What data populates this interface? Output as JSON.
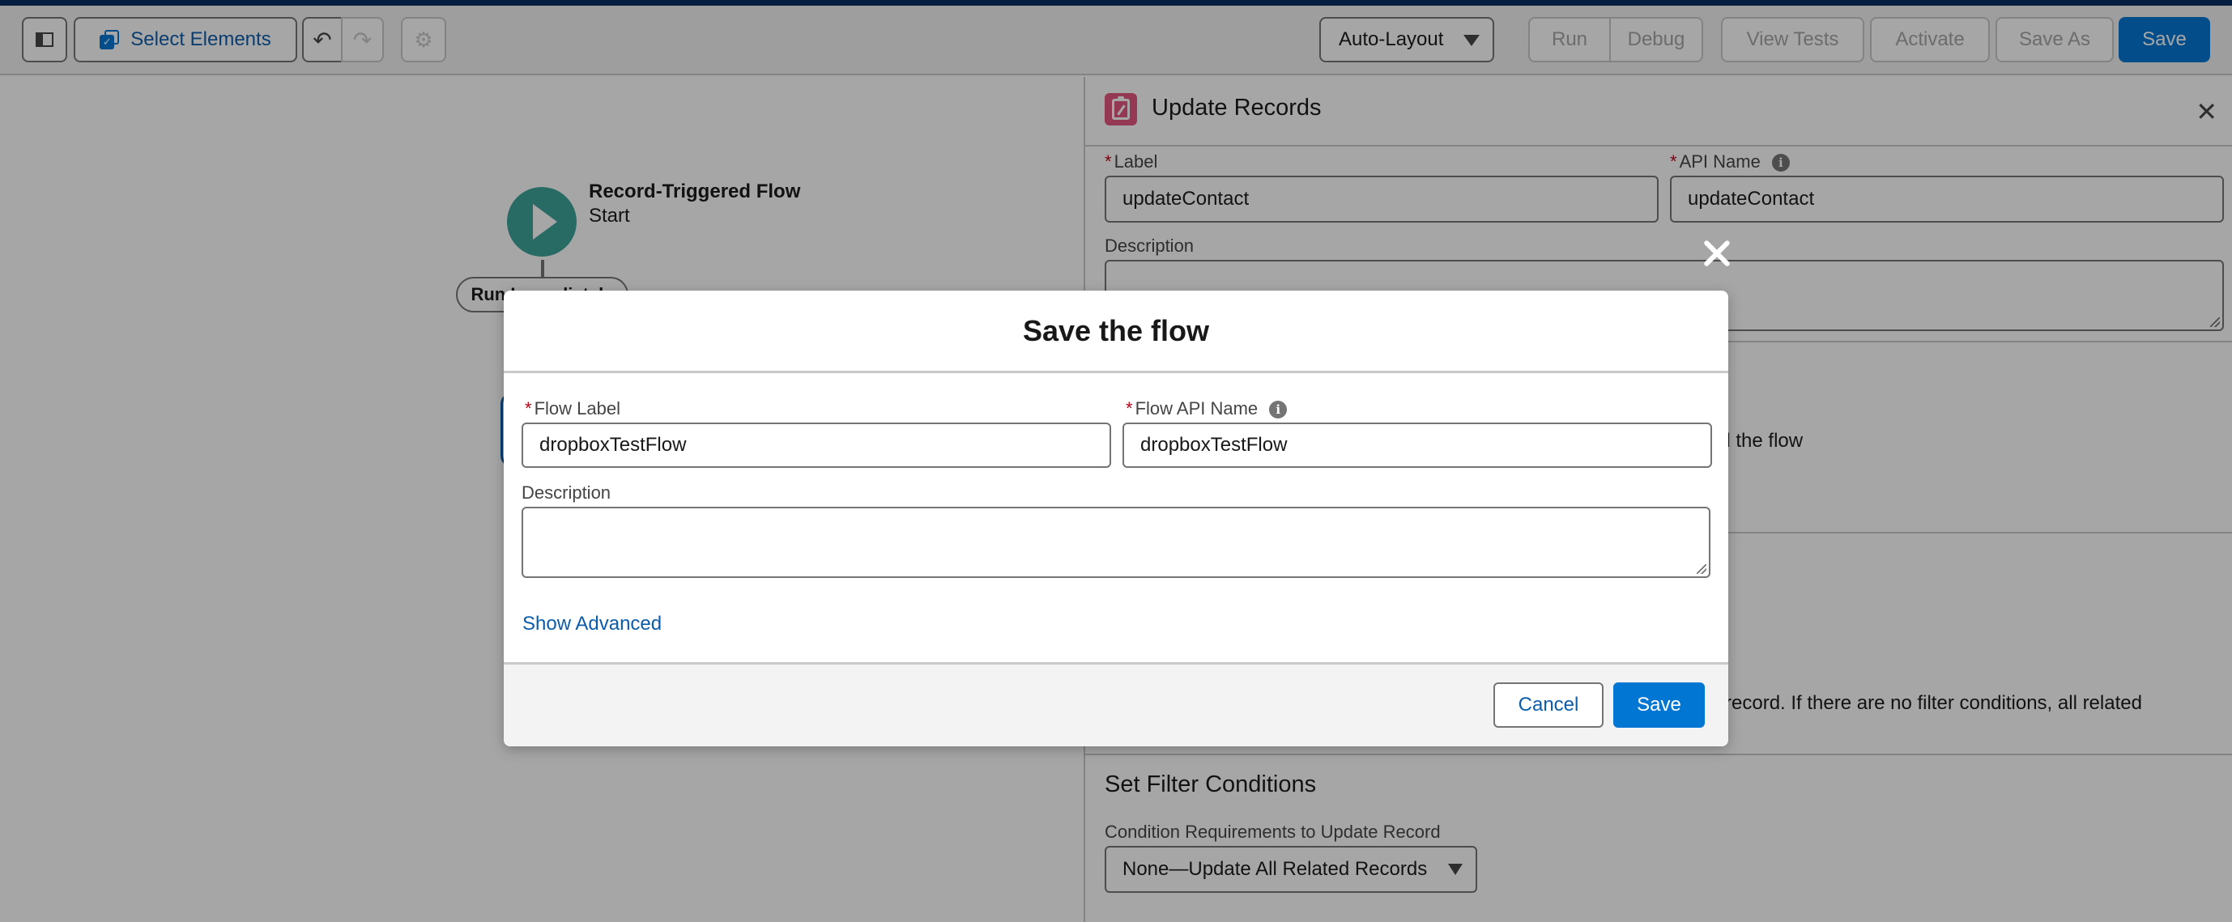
{
  "toolbar": {
    "select_elements_label": "Select Elements",
    "layout_mode": "Auto-Layout",
    "run_label": "Run",
    "debug_label": "Debug",
    "view_tests_label": "View Tests",
    "activate_label": "Activate",
    "save_as_label": "Save As",
    "save_label": "Save"
  },
  "canvas": {
    "start_node_title": "Record-Triggered Flow",
    "start_node_subtitle": "Start",
    "path_label": "Run Immediately"
  },
  "panel": {
    "title": "Update Records",
    "label_field_label": "Label",
    "label_field_value": "updateContact",
    "api_name_label": "API Name",
    "api_name_value": "updateContact",
    "description_label": "Description",
    "partial_text_1": "ed the flow",
    "partial_text_2": "g record. If there are no filter conditions, all related",
    "filter_section_title": "Set Filter Conditions",
    "condition_label": "Condition Requirements to Update Record",
    "condition_value": "None—Update All Related Records"
  },
  "modal": {
    "title": "Save the flow",
    "flow_label_label": "Flow Label",
    "flow_label_value": "dropboxTestFlow",
    "flow_api_name_label": "Flow API Name",
    "flow_api_name_value": "dropboxTestFlow",
    "description_label": "Description",
    "description_value": "",
    "show_advanced_label": "Show Advanced",
    "cancel_label": "Cancel",
    "save_label": "Save"
  },
  "icons": {
    "info": "i",
    "required_marker": "*",
    "panel_close": "✕"
  },
  "colors": {
    "brand_blue": "#0176d3",
    "link_blue": "#0b5cab",
    "start_node_teal": "#3ba39a",
    "update_records_pink": "#e3547f",
    "required_red": "#ba0517"
  }
}
